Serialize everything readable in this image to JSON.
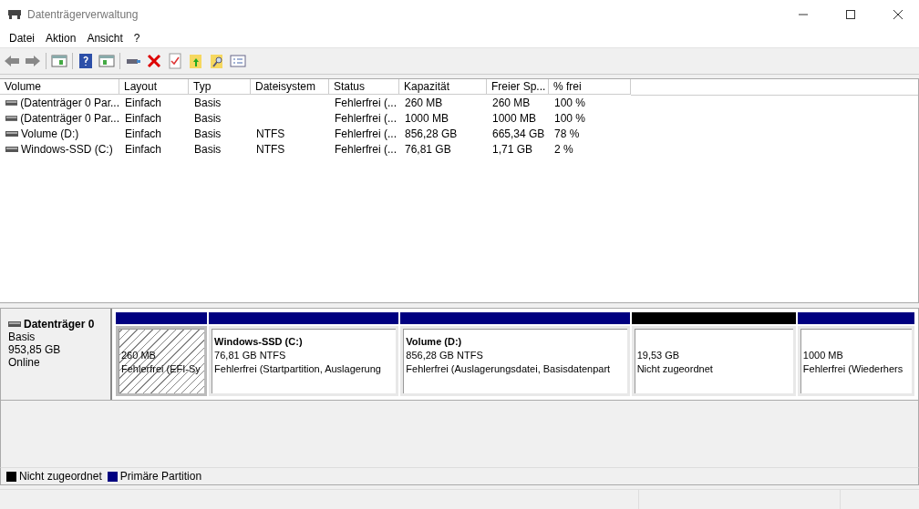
{
  "window": {
    "title": "Datenträgerverwaltung"
  },
  "menu": [
    "Datei",
    "Aktion",
    "Ansicht",
    "?"
  ],
  "table": {
    "columns": [
      "Volume",
      "Layout",
      "Typ",
      "Dateisystem",
      "Status",
      "Kapazität",
      "Freier Sp...",
      "% frei"
    ],
    "rows": [
      [
        "(Datenträger 0 Par...",
        "Einfach",
        "Basis",
        "",
        "Fehlerfrei (...",
        "260 MB",
        "260 MB",
        "100 %"
      ],
      [
        "(Datenträger 0 Par...",
        "Einfach",
        "Basis",
        "",
        "Fehlerfrei (...",
        "1000 MB",
        "1000 MB",
        "100 %"
      ],
      [
        "Volume (D:)",
        "Einfach",
        "Basis",
        "NTFS",
        "Fehlerfrei (...",
        "856,28 GB",
        "665,34 GB",
        "78 %"
      ],
      [
        "Windows-SSD (C:)",
        "Einfach",
        "Basis",
        "NTFS",
        "Fehlerfrei (...",
        "76,81 GB",
        "1,71 GB",
        "2 %"
      ]
    ]
  },
  "disk": {
    "name": "Datenträger 0",
    "type": "Basis",
    "size": "953,85 GB",
    "state": "Online",
    "partitions": [
      {
        "kind": "primary",
        "selected": true,
        "size": "260 MB",
        "status": "Fehlerfrei (EFI-Sy"
      },
      {
        "kind": "primary",
        "selected": false,
        "name": "Windows-SSD  (C:)",
        "size": "76,81 GB NTFS",
        "status": "Fehlerfrei (Startpartition, Auslagerung"
      },
      {
        "kind": "primary",
        "selected": false,
        "name": "Volume  (D:)",
        "size": "856,28 GB NTFS",
        "status": "Fehlerfrei (Auslagerungsdatei, Basisdatenpart"
      },
      {
        "kind": "unallocated",
        "selected": false,
        "size": "19,53 GB",
        "status": "Nicht zugeordnet"
      },
      {
        "kind": "primary",
        "selected": false,
        "size": "1000 MB",
        "status": "Fehlerfrei (Wiederhers"
      }
    ]
  },
  "legend": [
    {
      "label": "Nicht zugeordnet",
      "color": "#000000"
    },
    {
      "label": "Primäre Partition",
      "color": "#000080"
    }
  ]
}
